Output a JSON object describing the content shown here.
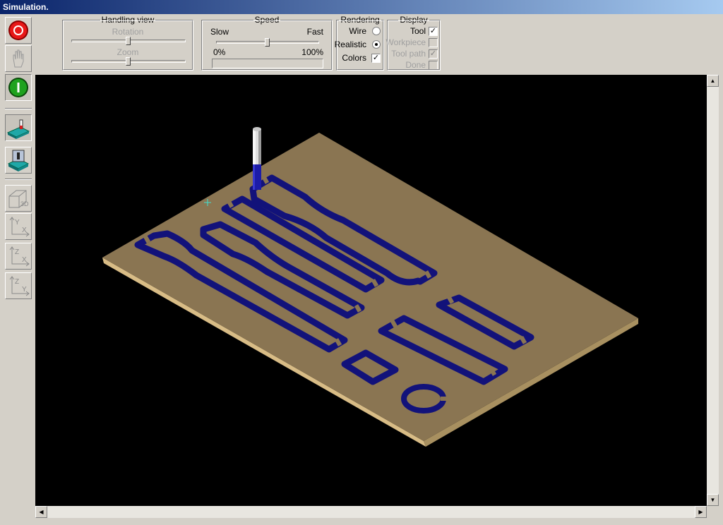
{
  "window": {
    "title": "Simulation."
  },
  "toolbar": {
    "buttons": [
      {
        "icon": "stop-icon",
        "state": "raised"
      },
      {
        "icon": "hand-pan-icon",
        "state": "disabled"
      },
      {
        "icon": "start-icon",
        "state": "sunken"
      },
      {
        "icon": "workpiece-view-icon",
        "state": "sunken"
      },
      {
        "icon": "machine-view-icon",
        "state": "raised"
      },
      {
        "icon": "3d-view-icon",
        "label": "3D"
      },
      {
        "icon": "view-yx-icon",
        "axes": [
          "Y",
          "X"
        ]
      },
      {
        "icon": "view-zx-icon",
        "axes": [
          "Z",
          "X"
        ]
      },
      {
        "icon": "view-zy-icon",
        "axes": [
          "Z",
          "Y"
        ]
      }
    ]
  },
  "handling_view": {
    "title": "Handling view",
    "rotation_label": "Rotation",
    "zoom_label": "Zoom",
    "rotation_value": 0.5,
    "zoom_value": 0.5
  },
  "speed": {
    "title": "Speed",
    "slow": "Slow",
    "fast": "Fast",
    "min": "0%",
    "max": "100%",
    "value": 0.5,
    "progress": 0
  },
  "rendering": {
    "title": "Rendering",
    "wire": "Wire",
    "realistic": "Realistic",
    "colors": "Colors",
    "selected": "realistic",
    "colors_checked": true
  },
  "display": {
    "title": "Display",
    "tool": "Tool",
    "workpiece": "Workpiece",
    "toolpath": "Tool path",
    "done": "Done",
    "tool_checked": true,
    "toolpath_checked": true
  },
  "colors": {
    "board_top": "#8a7552",
    "board_edge": "#d8bc86",
    "groove": "#12127a",
    "background": "#000000",
    "cursor": "#40e0d0"
  }
}
